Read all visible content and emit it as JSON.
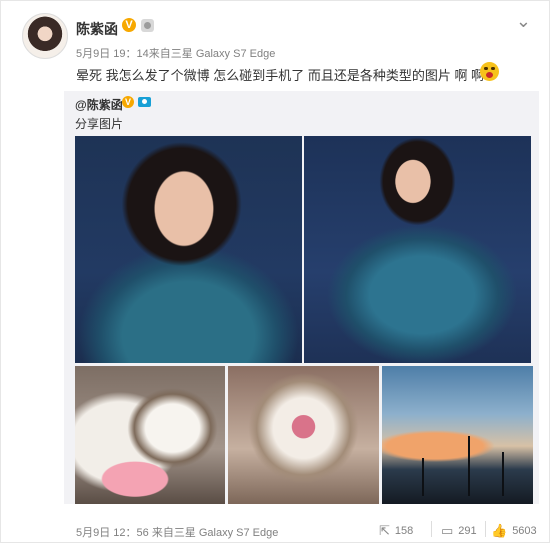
{
  "post": {
    "author": "陈紫函",
    "meta": "5月9日 19：14来自三星 Galaxy S7 Edge",
    "text": "晕死 我怎么发了个微博 怎么碰到手机了 而且还是各种类型的图片 啊 啊"
  },
  "repost": {
    "author": "@陈紫函",
    "label": "分享图片",
    "images": [
      "portrait-photo-1",
      "portrait-photo-2",
      "cat-cake-photo",
      "cat-closeup-photo",
      "sunset-palms-photo"
    ]
  },
  "footer": {
    "meta": "5月9日 12：56 来自三星 Galaxy S7 Edge",
    "reposts": "158",
    "comments": "291",
    "likes": "5603"
  },
  "icons": {
    "verified": "verified-badge-icon",
    "rank": "level-icon",
    "menu": "chevron-down-icon",
    "emoji": "shocked-emoji-icon",
    "camera": "camera-icon",
    "repost": "repost-icon",
    "comment": "comment-icon",
    "like": "thumbs-up-icon"
  },
  "colors": {
    "accent": "#f7a800",
    "camera": "#18a0d6"
  }
}
